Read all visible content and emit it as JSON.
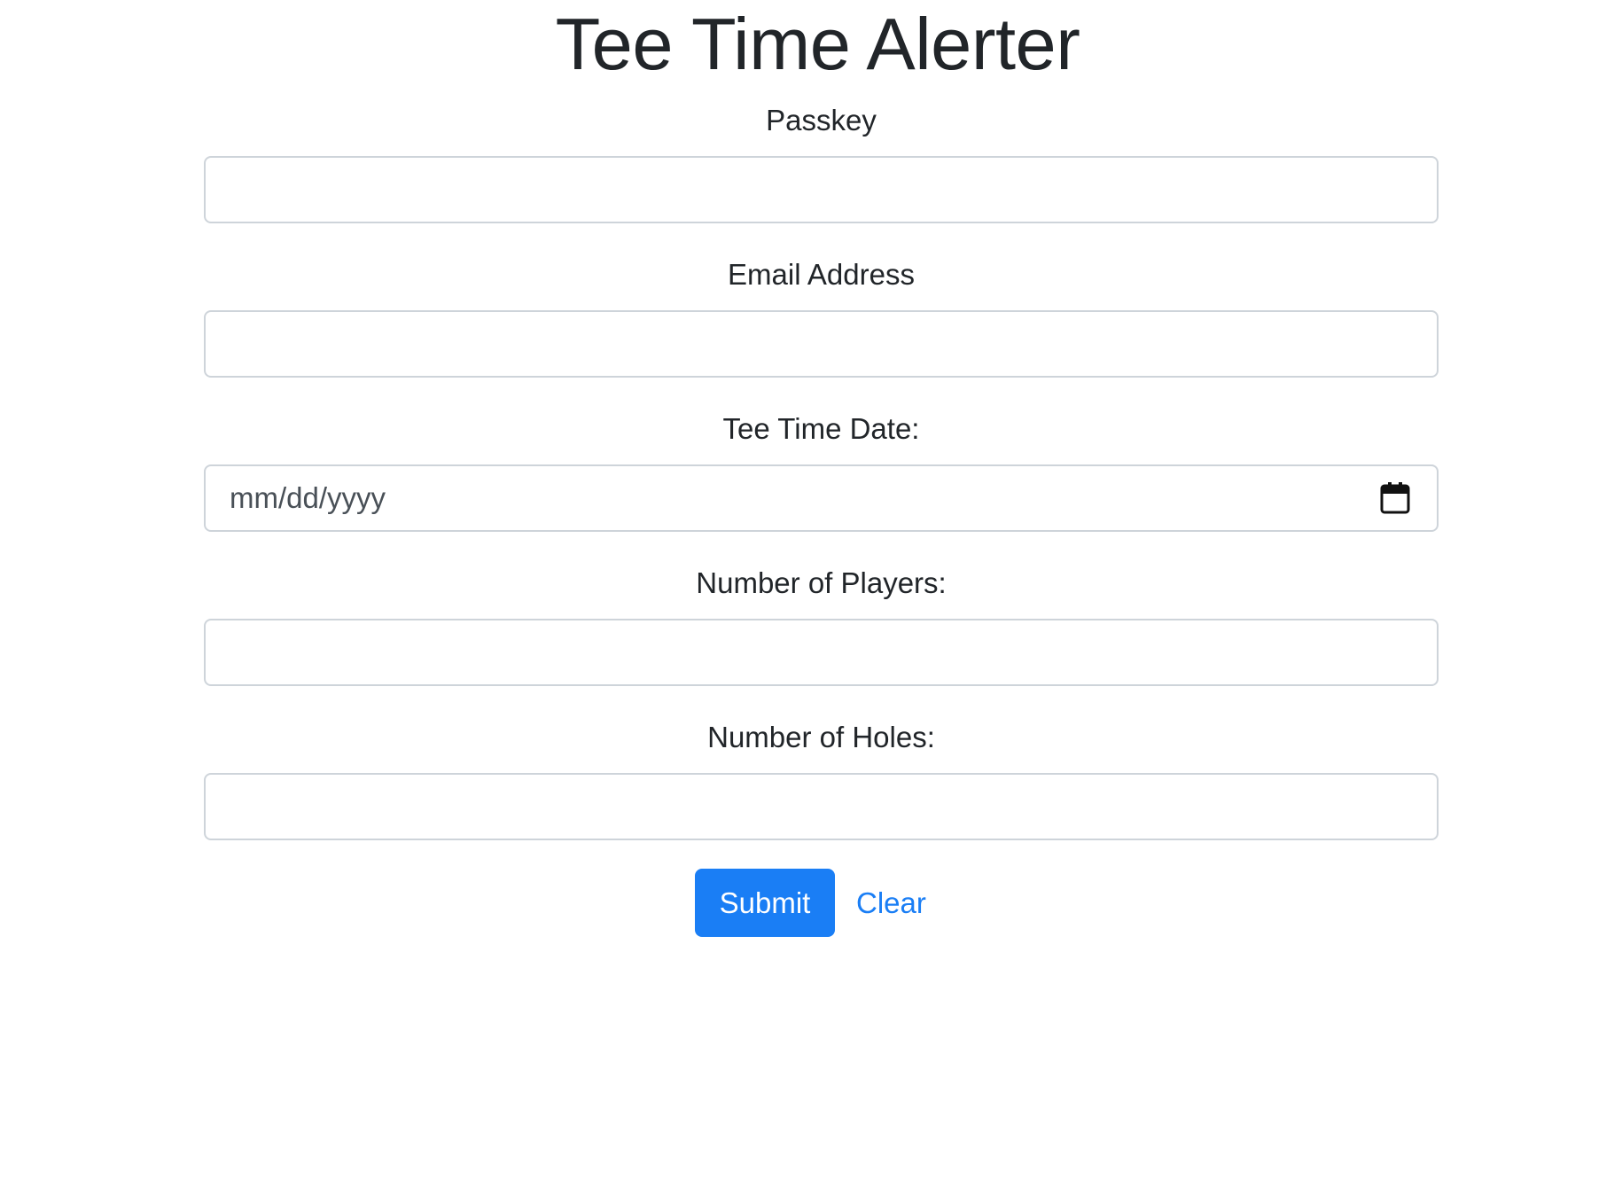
{
  "page": {
    "title": "Tee Time Alerter"
  },
  "form": {
    "passkey": {
      "label": "Passkey",
      "value": "",
      "placeholder": ""
    },
    "email": {
      "label": "Email Address",
      "value": "",
      "placeholder": ""
    },
    "date": {
      "label": "Tee Time Date:",
      "placeholder": "mm/dd/yyyy",
      "icon": "calendar-icon"
    },
    "players": {
      "label": "Number of Players:",
      "value": "",
      "placeholder": ""
    },
    "holes": {
      "label": "Number of Holes:",
      "value": "",
      "placeholder": ""
    },
    "submit_label": "Submit",
    "clear_label": "Clear"
  },
  "colors": {
    "accent": "#1a7ef5",
    "text": "#212529",
    "input_border": "#ced4da"
  }
}
